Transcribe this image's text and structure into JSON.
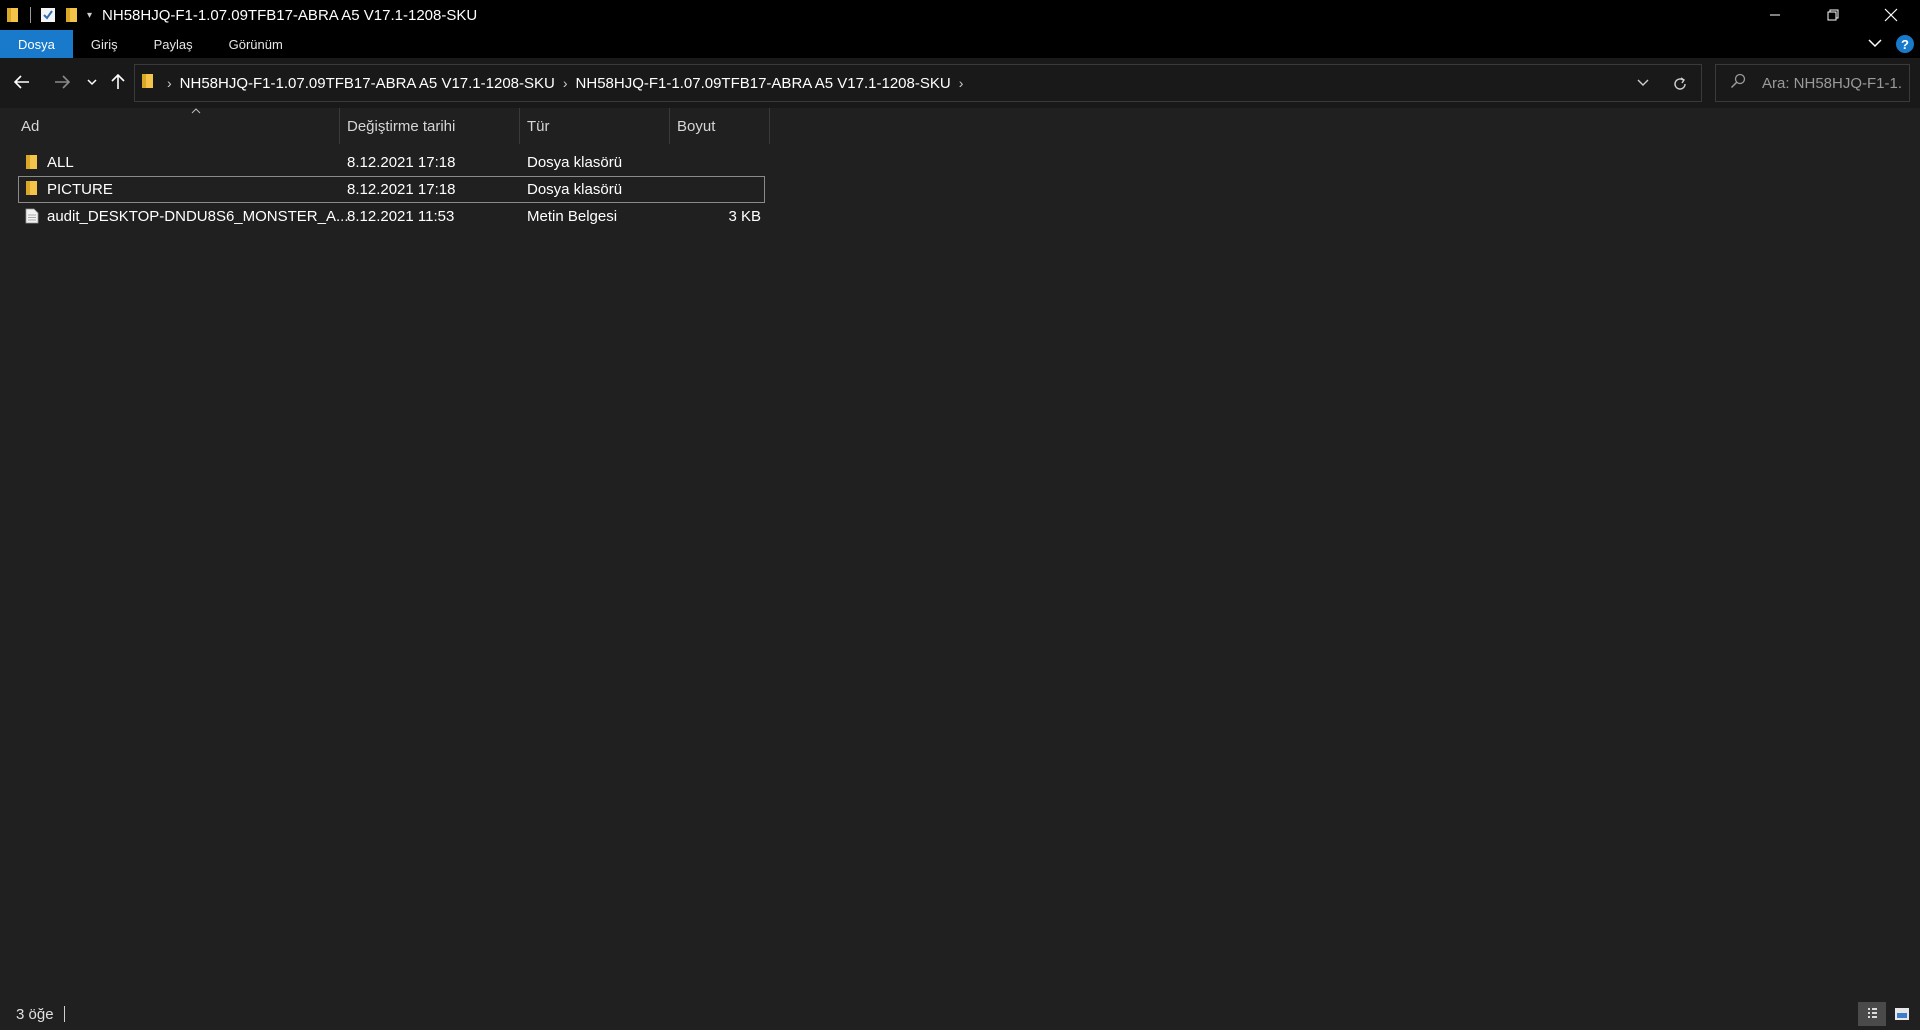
{
  "window": {
    "title": "NH58HJQ-F1-1.07.09TFB17-ABRA A5 V17.1-1208-SKU",
    "qat_dropdown": "▾"
  },
  "ribbon": {
    "tabs": [
      {
        "label": "Dosya",
        "active": true
      },
      {
        "label": "Giriş",
        "active": false
      },
      {
        "label": "Paylaş",
        "active": false
      },
      {
        "label": "Görünüm",
        "active": false
      }
    ],
    "help": "?"
  },
  "address": {
    "crumbs": [
      "NH58HJQ-F1-1.07.09TFB17-ABRA A5 V17.1-1208-SKU",
      "NH58HJQ-F1-1.07.09TFB17-ABRA A5 V17.1-1208-SKU"
    ],
    "separator": "›"
  },
  "search": {
    "placeholder": "Ara: NH58HJQ-F1-1..."
  },
  "columns": {
    "name": "Ad",
    "date": "Değiştirme tarihi",
    "type": "Tür",
    "size": "Boyut"
  },
  "files": [
    {
      "name": "ALL",
      "date": "8.12.2021 17:18",
      "type": "Dosya klasörü",
      "size": "",
      "icon": "folder-icon",
      "selected": false
    },
    {
      "name": "PICTURE",
      "date": "8.12.2021 17:18",
      "type": "Dosya klasörü",
      "size": "",
      "icon": "folder-icon",
      "selected": true
    },
    {
      "name": "audit_DESKTOP-DNDU8S6_MONSTER_A...",
      "date": "8.12.2021 11:53",
      "type": "Metin Belgesi",
      "size": "3 KB",
      "icon": "text-file-icon",
      "selected": false
    }
  ],
  "status": {
    "item_count": "3 öğe"
  },
  "colors": {
    "accent": "#1979ca",
    "folder": "#f3c449",
    "background": "#202020",
    "titlebar": "#000000"
  }
}
